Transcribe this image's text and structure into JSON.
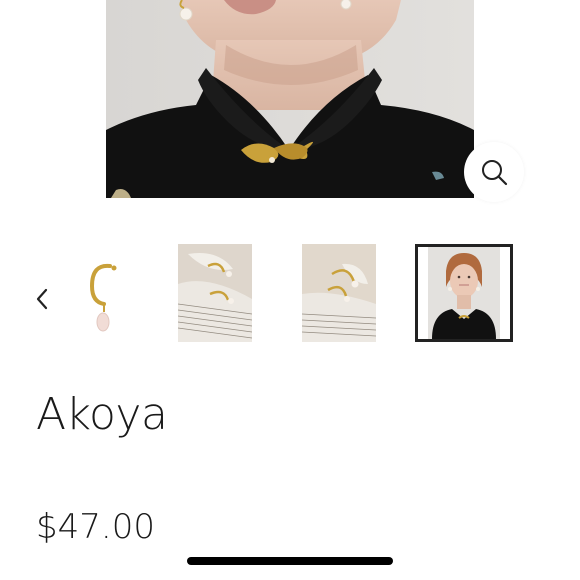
{
  "product": {
    "title": "Akoya",
    "price": "$47.00"
  },
  "gallery": {
    "main_image": "model-wearing-black-mandarin-collar-top-with-gold-leaf-brooch-and-pearl-earrings",
    "thumbnails": [
      {
        "name": "gold-hoop-pearl-drop-earring",
        "selected": false
      },
      {
        "name": "earrings-on-sheet-music",
        "selected": false
      },
      {
        "name": "earrings-on-sheet-music-closeup",
        "selected": false
      },
      {
        "name": "model-portrait",
        "selected": true
      }
    ]
  },
  "icons": {
    "zoom": "search-icon",
    "prev": "chevron-left-icon"
  },
  "colors": {
    "text": "#1a1a1a",
    "background": "#ffffff",
    "accent_gold": "#c9a13a"
  }
}
